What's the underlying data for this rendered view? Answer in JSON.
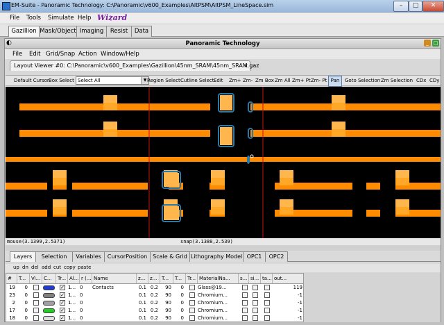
{
  "window": {
    "title": "EM-Suite - Panoramic Technology: C:\\Panoramic\\v600_Examples\\AltPSM\\AltPSM_LineSpace.sim",
    "min_icon": "minimize-icon",
    "max_icon": "maximize-icon",
    "close_icon": "close-icon"
  },
  "menubar": {
    "items": [
      "File",
      "Tools",
      "Simulate",
      "Help"
    ],
    "wizard": "Wizard"
  },
  "top_tabs": [
    "Gazillion",
    "Mask/Object",
    "Imaging",
    "Resist",
    "Data"
  ],
  "inner": {
    "title": "Panoramic Technology",
    "menu": [
      "File",
      "Edit",
      "Grid/Snap",
      "Action",
      "Window/Help"
    ],
    "doc_tab": "Layout Viewer #0: C:\\Panoramic\\v600_Examples\\Gazillion\\45nm_SRAM\\45nm_SRAM.gaz",
    "toolbar": {
      "default_cursor": "Default Cursor",
      "box_select": "Box Select",
      "select_value": "Select All",
      "region_select": "Region Select",
      "cutline_select": "Cutline Select",
      "edit": "Edit",
      "zm_plus": "Zm+",
      "zm_minus": "Zm-",
      "zm_box": "Zm Box",
      "zm_all": "Zm All",
      "zm_plus_pt": "Zm+ Pt",
      "zm_minus_pt": "Zm- Pt",
      "pan": "Pan",
      "goto_selection": "Goto Selection",
      "zm_selection": "Zm Selection",
      "cdx": "CDx",
      "cdy": "CDy"
    },
    "status": {
      "mouse": "mouse(3.1399,2.5371)",
      "snap": "snap(3.1388,2.539)"
    }
  },
  "bottom_tabs": [
    "Layers",
    "Selection",
    "Variables",
    "CursorPosition",
    "Scale & Grid",
    "Lithography Model",
    "OPC1",
    "OPC2"
  ],
  "layer_actions": [
    "up",
    "dn",
    "del",
    "add",
    "cut",
    "copy",
    "paste"
  ],
  "layer_table": {
    "headers": [
      "#",
      "T...",
      "Vi...",
      "C...",
      "Tr...",
      "Al...",
      "r (...",
      "Name",
      "z...",
      "z...",
      "T...",
      "T...",
      "Tr...",
      "MaterialNa...",
      "s...",
      "si...",
      "ta...",
      "out..."
    ],
    "rows": [
      {
        "num": "19",
        "t": "0",
        "color": "#1f3bd6",
        "al": "1...",
        "r": "0",
        "name": "Contacts",
        "z1": "0.1",
        "z2": "0.2",
        "t1": "90",
        "t2": "0",
        "material": "Glass@19...",
        "out": "119"
      },
      {
        "num": "23",
        "t": "0",
        "color": "#808080",
        "al": "1...",
        "r": "0",
        "name": "",
        "z1": "0.1",
        "z2": "0.2",
        "t1": "90",
        "t2": "0",
        "material": "Chromium...",
        "out": "-1"
      },
      {
        "num": "2",
        "t": "0",
        "color": "#a0a0a0",
        "al": "1...",
        "r": "0",
        "name": "",
        "z1": "0.1",
        "z2": "0.2",
        "t1": "90",
        "t2": "0",
        "material": "Chromium...",
        "out": "-1"
      },
      {
        "num": "17",
        "t": "0",
        "color": "#22cc22",
        "al": "1...",
        "r": "0",
        "name": "",
        "z1": "0.1",
        "z2": "0.2",
        "t1": "90",
        "t2": "0",
        "material": "Chromium...",
        "out": "-1"
      },
      {
        "num": "18",
        "t": "0",
        "color": "#e0e0e0",
        "al": "1...",
        "r": "0",
        "name": "",
        "z1": "0.1",
        "z2": "0.2",
        "t1": "90",
        "t2": "0",
        "material": "Chromium...",
        "out": "-1"
      }
    ]
  },
  "colors": {
    "gate": "#ff8c00",
    "contact": "#ffa726",
    "contact_fill": "#ffb74d",
    "cutline": "#cc1111",
    "contour": "#2a79a8",
    "canvas_bg": "#000000"
  }
}
